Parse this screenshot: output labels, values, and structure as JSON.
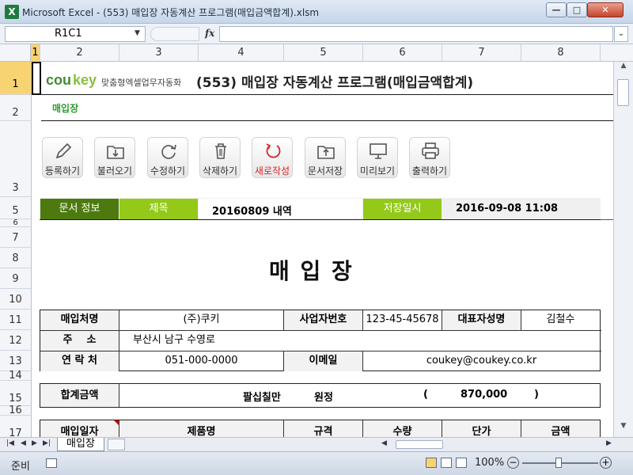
{
  "window": {
    "title": "Microsoft Excel - (553) 매입장 자동계산 프로그램(매입금액합계).xlsm",
    "app_icon": "X",
    "minimize": "—",
    "maximize": "□",
    "close": "✕"
  },
  "formula_bar": {
    "name_box": "R1C1",
    "fx": "fx",
    "formula": ""
  },
  "columns": [
    "1",
    "2",
    "3",
    "4",
    "5",
    "6",
    "7",
    "8"
  ],
  "rows": [
    "1",
    "2",
    "3",
    "5",
    "6",
    "7",
    "8",
    "9",
    "10",
    "11",
    "12",
    "13",
    "14",
    "15",
    "16",
    "17"
  ],
  "sheet": {
    "logo_cou": "cou",
    "logo_key": "key",
    "logo_sub": "맞춤형엑셀업무자동화",
    "title": "(553) 매입장 자동계산 프로그램(매입금액합계)",
    "subtitle": "매입장",
    "toolbar": [
      {
        "label": "등록하기",
        "icon": "pencil-icon"
      },
      {
        "label": "불러오기",
        "icon": "folder-download-icon"
      },
      {
        "label": "수정하기",
        "icon": "refresh-icon"
      },
      {
        "label": "삭제하기",
        "icon": "trash-icon"
      },
      {
        "label": "새로작성",
        "icon": "new-cycle-icon"
      },
      {
        "label": "문서저장",
        "icon": "folder-upload-icon"
      },
      {
        "label": "미리보기",
        "icon": "monitor-icon"
      },
      {
        "label": "출력하기",
        "icon": "printer-icon"
      }
    ],
    "docinfo": {
      "label": "문서 정보",
      "title_label": "제목",
      "title_value": "20160809 내역",
      "saved_label": "저장일시",
      "saved_value": "2016-09-08 11:08"
    },
    "doc_title": "매 입 장",
    "vendor": {
      "name_label": "매입처명",
      "name_value": "(주)쿠키",
      "bizno_label": "사업자번호",
      "bizno_value": "123-45-45678",
      "ceo_label": "대표자성명",
      "ceo_value": "김철수",
      "addr_label": "주    소",
      "addr_value": "부산시 남구 수영로",
      "phone_label": "연 락 처",
      "phone_value": "051-000-0000",
      "email_label": "이메일",
      "email_value": "coukey@coukey.co.kr"
    },
    "total": {
      "label": "합계금액",
      "text": "팔십칠만",
      "unit": "원정",
      "open": "(",
      "amount": "870,000",
      "close": ")"
    },
    "items_header": [
      "매입일자",
      "제품명",
      "규격",
      "수량",
      "단가",
      "금액"
    ]
  },
  "tabs": {
    "active": "매입장"
  },
  "status": {
    "text": "준비",
    "zoom": "100%"
  },
  "colors": {
    "green_dark": "#4d7a0f",
    "green_light": "#94c91a",
    "accent_red": "#d6282b"
  }
}
